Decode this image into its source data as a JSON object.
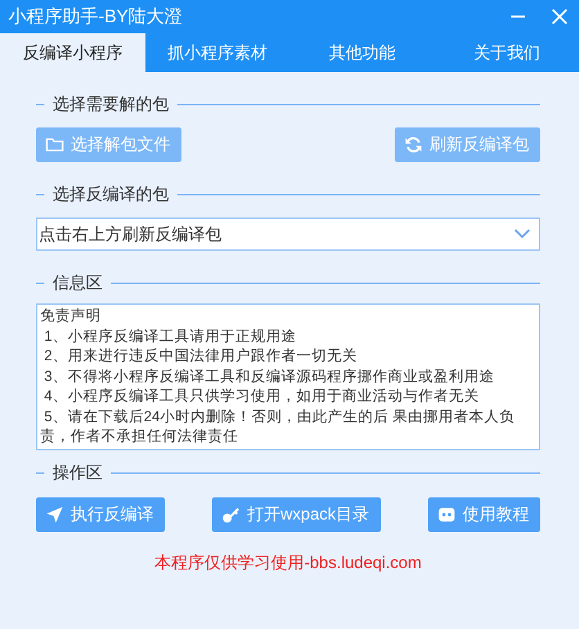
{
  "window": {
    "title": "小程序助手-BY陆大澄"
  },
  "tabs": [
    {
      "label": "反编译小程序",
      "selected": true
    },
    {
      "label": "抓小程序素材",
      "selected": false
    },
    {
      "label": "其他功能",
      "selected": false
    },
    {
      "label": "关于我们",
      "selected": false
    }
  ],
  "sections": [
    {
      "kind": "buttons",
      "title": "选择需要解的包",
      "buttons": [
        {
          "label": "选择解包文件",
          "disabled": true
        },
        {
          "label": "刷新反编译包",
          "disabled": true
        }
      ]
    },
    {
      "kind": "dropdown",
      "title": "选择反编译的包",
      "value": "点击右上方刷新反编译包"
    },
    {
      "kind": "info",
      "title": "信息区",
      "lines": [
        "免责声明",
        " 1、小程序反编译工具请用于正规用途",
        " 2、用来进行违反中国法律用户跟作者一切无关",
        " 3、不得将小程序反编译工具和反编译源码程序挪作商业或盈利用途",
        " 4、小程序反编译工具只供学习使用，如用于商业活动与作者无关",
        " 5、请在下载后24小时内删除！否则，由此产生的后 果由挪用者本人负责，作者不承担任何法律责任"
      ]
    },
    {
      "kind": "buttons",
      "title": "操作区",
      "buttons": [
        {
          "label": "执行反编译",
          "disabled": false
        },
        {
          "label": "打开wxpack目录",
          "disabled": false
        },
        {
          "label": "使用教程",
          "disabled": false
        }
      ]
    }
  ],
  "footer": "本程序仅供学习使用-bbs.ludeqi.com"
}
